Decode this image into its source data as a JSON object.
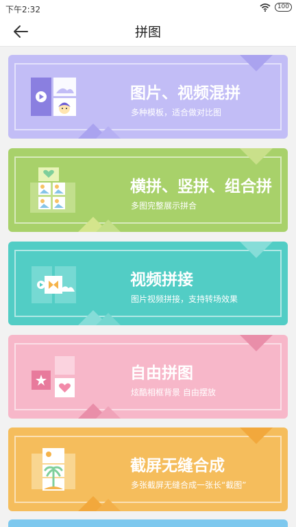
{
  "status_bar": {
    "time": "下午2:32",
    "battery": "100"
  },
  "header": {
    "title": "拼图"
  },
  "cards": [
    {
      "title": "图片、视频混拼",
      "subtitle": "多种模板，适合做对比图",
      "color": "#c2bdf6",
      "icon": "image-video-mix-icon"
    },
    {
      "title": "横拼、竖拼、组合拼",
      "subtitle": "多图完整展示拼合",
      "color": "#a8d16a",
      "icon": "grid-collage-icon"
    },
    {
      "title": "视频拼接",
      "subtitle": "图片视频拼接，支持转场效果",
      "color": "#52cdc5",
      "icon": "video-join-icon"
    },
    {
      "title": "自由拼图",
      "subtitle": "炫酷相框背景 自由摆放",
      "color": "#f7b7c9",
      "icon": "free-collage-icon"
    },
    {
      "title": "截屏无缝合成",
      "subtitle": "多张截屏无缝合成一张长“截图”",
      "color": "#f5bd5c",
      "icon": "screenshot-stitch-icon"
    }
  ]
}
